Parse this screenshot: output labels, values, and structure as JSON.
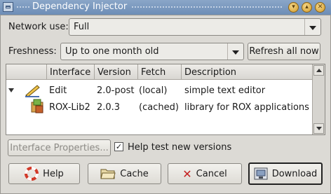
{
  "window": {
    "title": "Dependency Injector"
  },
  "network": {
    "label": "Network use:",
    "value": "Full"
  },
  "freshness": {
    "label": "Freshness:",
    "value": "Up to one month old",
    "refresh_label": "Refresh all now"
  },
  "table": {
    "columns": [
      "",
      "Interface",
      "Version",
      "Fetch",
      "Description"
    ],
    "rows": [
      {
        "interface": "Edit",
        "version": "2.0-post",
        "fetch": "(local)",
        "description": "simple text editor",
        "icon": "edit-pen-icon"
      },
      {
        "interface": "ROX-Lib2",
        "version": "2.0.3",
        "fetch": "(cached)",
        "description": "library for ROX applications",
        "icon": "library-package-icon"
      }
    ]
  },
  "actions": {
    "interface_properties": "Interface Properties...",
    "help_test_label": "Help test new versions",
    "help_test_checked": true
  },
  "buttons": {
    "help": "Help",
    "cache": "Cache",
    "cancel": "Cancel",
    "download": "Download"
  }
}
